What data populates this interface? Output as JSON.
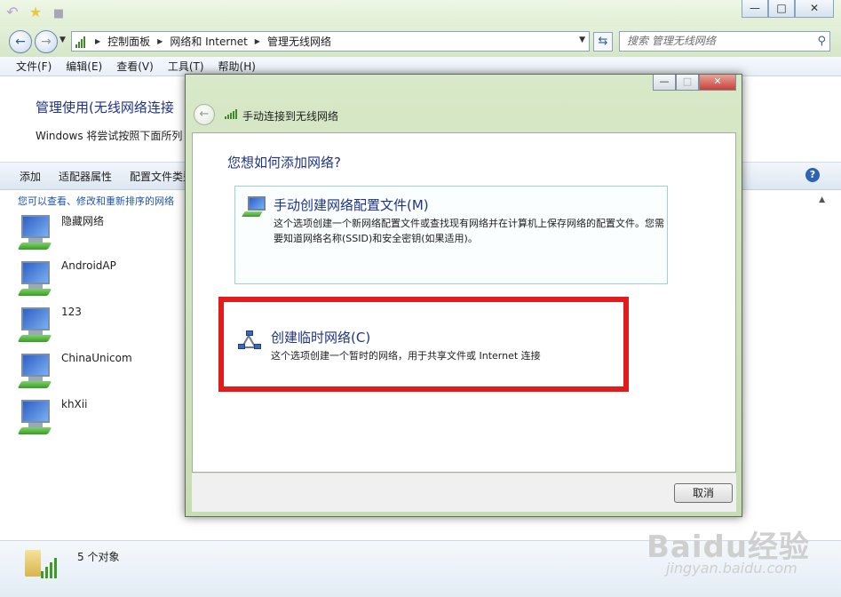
{
  "addressbar": {
    "crumbs": [
      "控制面板",
      "网络和 Internet",
      "管理无线网络"
    ],
    "search_placeholder": "搜索 管理无线网络"
  },
  "menubar": [
    "文件(F)",
    "编辑(E)",
    "查看(V)",
    "工具(T)",
    "帮助(H)"
  ],
  "page": {
    "title": "管理使用(无线网络连接",
    "subtitle": "Windows 将尝试按照下面所列",
    "hint": "您可以查看、修改和重新排序的网络"
  },
  "commandbar": [
    "添加",
    "适配器属性",
    "配置文件类型"
  ],
  "networks": [
    "隐藏网络",
    "AndroidAP",
    "123",
    "ChinaUnicom",
    "khXii"
  ],
  "status": {
    "count_text": "5 个对象"
  },
  "dialog": {
    "title": "手动连接到无线网络",
    "question": "您想如何添加网络?",
    "option1": {
      "title": "手动创建网络配置文件(M)",
      "desc": "这个选项创建一个新网络配置文件或查找现有网络并在计算机上保存网络的配置文件。您需要知道网络名称(SSID)和安全密钥(如果适用)。"
    },
    "option2": {
      "title": "创建临时网络(C)",
      "desc": "这个选项创建一个暂时的网络，用于共享文件或 Internet 连接"
    },
    "cancel_label": "取消"
  },
  "watermark": {
    "logo": "Baidu经验",
    "sub": "jingyan.baidu.com"
  },
  "colors": {
    "highlight": "#e21b1b",
    "heading": "#1e3287",
    "link": "#1d52b1"
  }
}
